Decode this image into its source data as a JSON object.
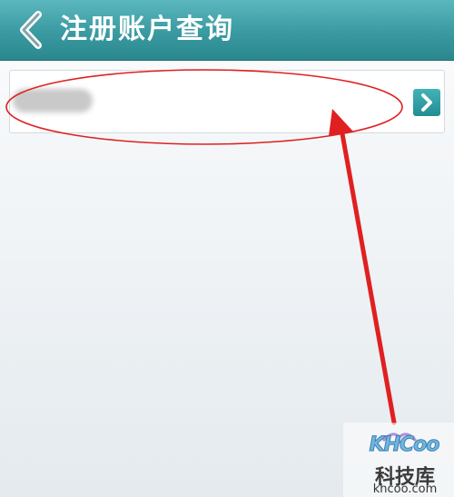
{
  "header": {
    "title": "注册账户查询",
    "back_icon": "chevron-left-icon"
  },
  "account_row": {
    "next_icon": "chevron-right-icon"
  },
  "annotation": {
    "color": "#e02020"
  },
  "watermark": {
    "logo_text": "KHCoo",
    "chinese_text": "科技库",
    "url_text": "khcoo.com"
  },
  "colors": {
    "header_top": "#5ab7bd",
    "header_bottom": "#2b878e",
    "accent": "#228d93"
  }
}
